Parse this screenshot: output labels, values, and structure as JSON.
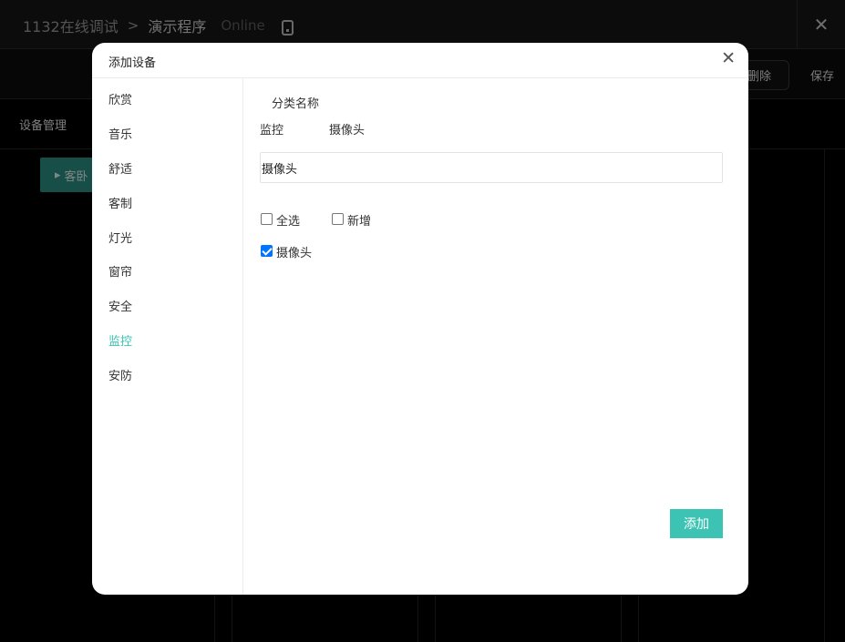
{
  "app": {
    "breadcrumb": {
      "root": "1132在线调试",
      "separator": ">",
      "program": "演示程序",
      "status": "Online"
    },
    "close_symbol": "✕",
    "toolbar": {
      "delete_label": "删除",
      "save_label": "保存"
    },
    "section_title": "设备管理",
    "room_button": {
      "arrow": "▸",
      "label": "客卧"
    }
  },
  "modal": {
    "title": "添加设备",
    "close_symbol": "✕",
    "sidebar": {
      "items": [
        "欣赏",
        "音乐",
        "舒适",
        "客制",
        "灯光",
        "窗帘",
        "安全",
        "监控",
        "安防"
      ],
      "active_index": 7
    },
    "category_label": "分类名称",
    "category_parent": "监控",
    "category_child": "摄像头",
    "name_input_value": "摄像头",
    "select_all_label": "全选",
    "select_all_checked": false,
    "add_new_label": "新增",
    "add_new_checked": false,
    "device_label": "摄像头",
    "device_checked": true,
    "add_button_label": "添加"
  },
  "colors": {
    "accent": "#3cc3b3",
    "room_button": "#2d8f84",
    "checkbox": "#0075ff"
  }
}
